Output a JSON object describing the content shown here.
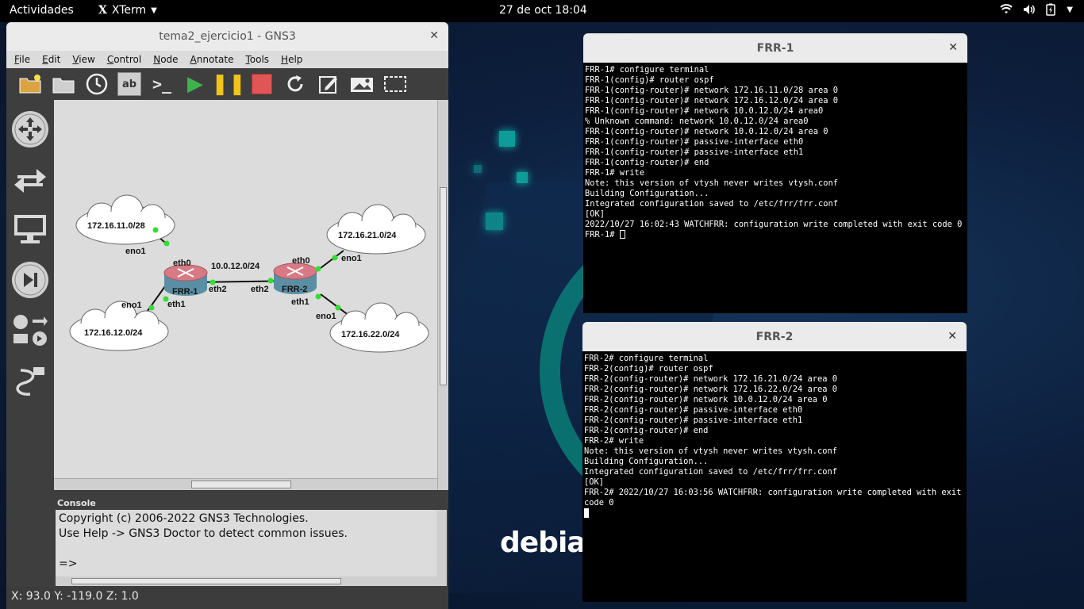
{
  "topbar": {
    "activities": "Actividades",
    "app_name": "XTerm",
    "clock": "27 de oct  18:04"
  },
  "gns3": {
    "title": "tema2_ejercicio1 - GNS3",
    "menu": [
      "File",
      "Edit",
      "View",
      "Control",
      "Node",
      "Annotate",
      "Tools",
      "Help"
    ],
    "topology": {
      "clouds": [
        {
          "label": "172.16.11.0/28"
        },
        {
          "label": "172.16.12.0/24"
        },
        {
          "label": "172.16.21.0/24"
        },
        {
          "label": "172.16.22.0/24"
        }
      ],
      "routers": [
        {
          "label": "FRR-1"
        },
        {
          "label": "FRR-2"
        }
      ],
      "link_label": "10.0.12.0/24",
      "ports": {
        "frr1_eth0": "eth0",
        "frr1_eth1": "eth1",
        "frr1_eth2": "eth2",
        "frr2_eth0": "eth0",
        "frr2_eth1": "eth1",
        "frr2_eth2": "eth2",
        "cloud11_eno1": "eno1",
        "cloud12_eno1": "eno1",
        "cloud21_eno1": "eno1",
        "cloud22_eno1": "eno1"
      }
    },
    "console": {
      "title": "Console",
      "lines": [
        "Copyright (c) 2006-2022 GNS3 Technologies.",
        "Use Help -> GNS3 Doctor to detect common issues.",
        "",
        "=>"
      ]
    },
    "status": "X: 93.0 Y: -119.0 Z: 1.0"
  },
  "terminals": {
    "frr1": {
      "title": "FRR-1",
      "text": "FRR-1# configure terminal\nFRR-1(config)# router ospf\nFRR-1(config-router)# network 172.16.11.0/28 area 0\nFRR-1(config-router)# network 172.16.12.0/24 area 0\nFRR-1(config-router)# network 10.0.12.0/24 area0\n% Unknown command: network 10.0.12.0/24 area0\nFRR-1(config-router)# network 10.0.12.0/24 area 0\nFRR-1(config-router)# passive-interface eth0\nFRR-1(config-router)# passive-interface eth1\nFRR-1(config-router)# end\nFRR-1# write\nNote: this version of vtysh never writes vtysh.conf\nBuilding Configuration...\nIntegrated configuration saved to /etc/frr/frr.conf\n[OK]\n2022/10/27 16:02:43 WATCHFRR: configuration write completed with exit code 0\nFRR-1# "
    },
    "frr2": {
      "title": "FRR-2",
      "text": "FRR-2# configure terminal\nFRR-2(config)# router ospf\nFRR-2(config-router)# network 172.16.21.0/24 area 0\nFRR-2(config-router)# network 172.16.22.0/24 area 0\nFRR-2(config-router)# network 10.0.12.0/24 area 0\nFRR-2(config-router)# passive-interface eth0\nFRR-2(config-router)# passive-interface eth1\nFRR-2(config-router)# end\nFRR-2# write\nNote: this version of vtysh never writes vtysh.conf\nBuilding Configuration...\nIntegrated configuration saved to /etc/frr/frr.conf\n[OK]\nFRR-2# 2022/10/27 16:03:56 WATCHFRR: configuration write completed with exit code 0\n"
    }
  },
  "desktop": {
    "logo_text": "debian",
    "colors": {
      "accent_teal": "#0f9c98",
      "debian_red": "#d70751",
      "link_dot_green": "#33dd33"
    }
  }
}
